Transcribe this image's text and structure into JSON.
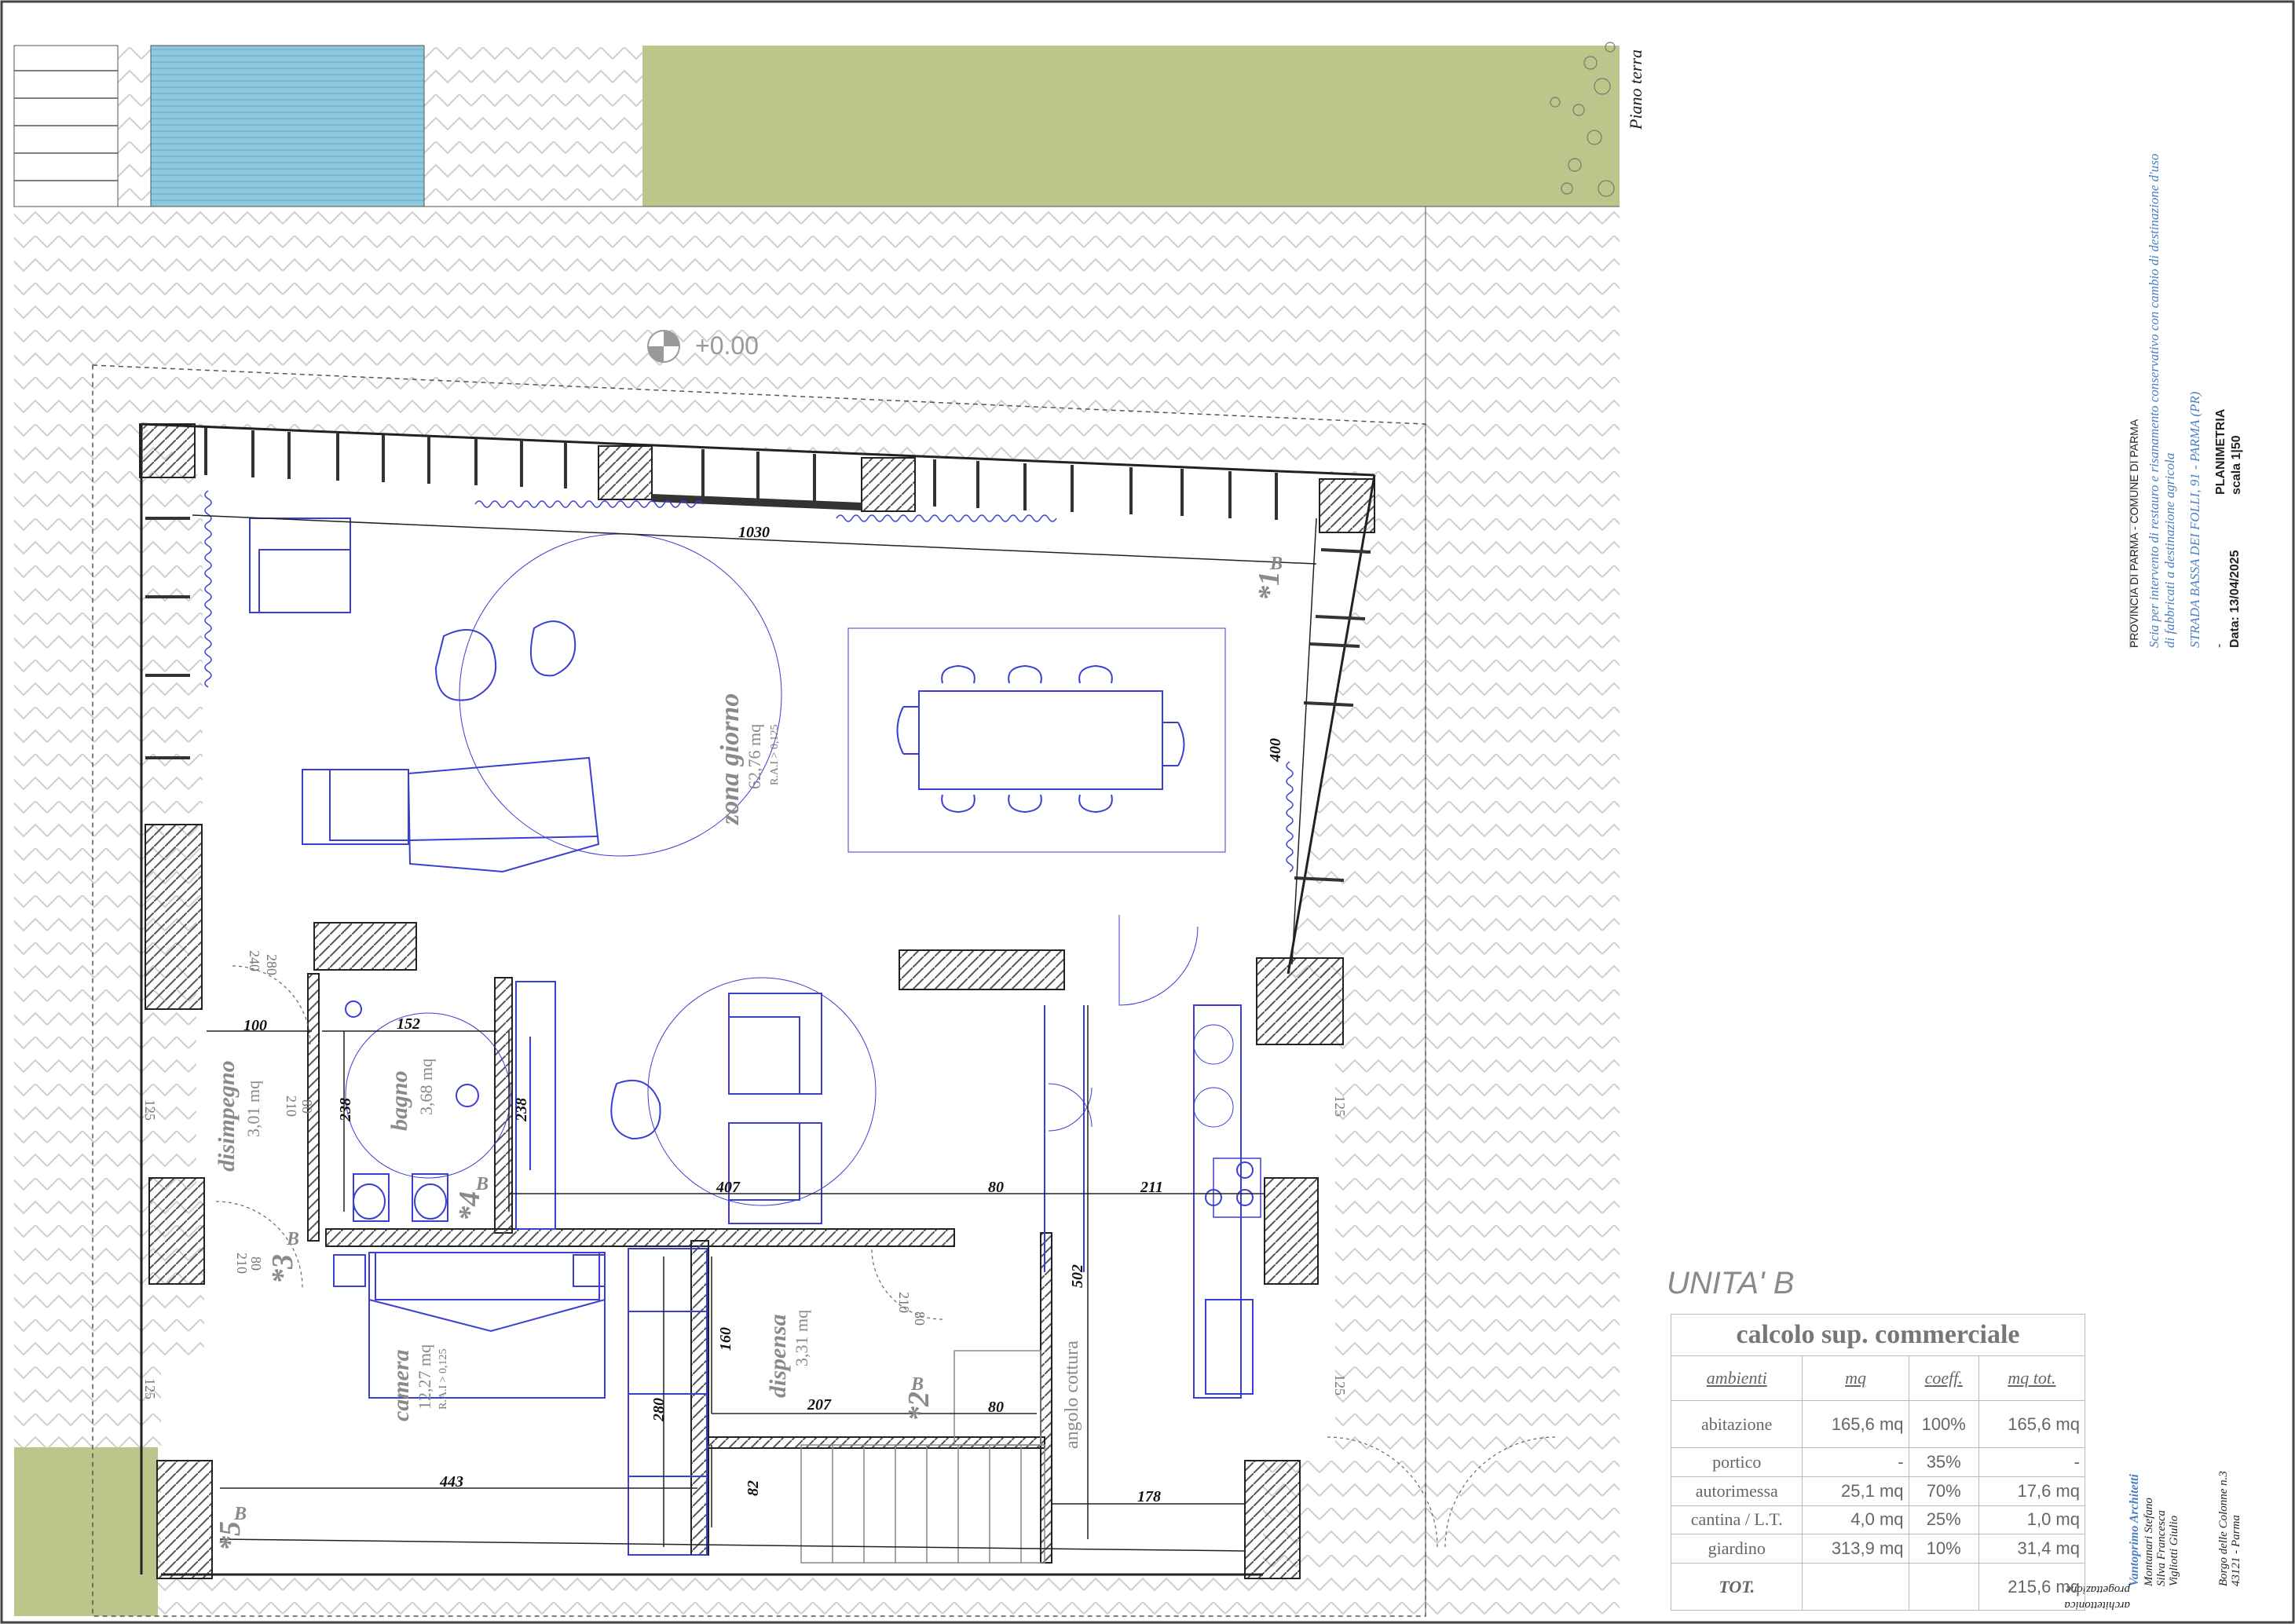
{
  "plan": {
    "level_label": "Piano terra",
    "elevation": "+0.00",
    "rooms": [
      {
        "id": "zona-giorno",
        "name": "zona giorno",
        "area": "62,76 mq",
        "ratio": "R.A.I > 0,125"
      },
      {
        "id": "disimpegno",
        "name": "disimpegno",
        "area": "3,01 mq"
      },
      {
        "id": "bagno",
        "name": "bagno",
        "area": "3,68 mq"
      },
      {
        "id": "camera",
        "name": "camera",
        "area": "12,27 mq",
        "ratio": "R.A.I > 0,125"
      },
      {
        "id": "dispensa",
        "name": "dispensa",
        "area": "3,31 mq"
      },
      {
        "id": "angolo-cottura",
        "name": "angolo cottura"
      }
    ],
    "dimensions": {
      "d1030": "1030",
      "d400": "400",
      "d100": "100",
      "d152": "152",
      "d238a": "238",
      "d238b": "238",
      "d407": "407",
      "d80a": "80",
      "d211": "211",
      "d502": "502",
      "d160": "160",
      "d207": "207",
      "d80b": "80",
      "d280": "280",
      "d443": "443",
      "d82": "82",
      "d178": "178"
    },
    "door_labels": {
      "w80": "80",
      "h210": "210",
      "w280": "280",
      "h240": "240",
      "w125": "125"
    },
    "tags": {
      "t1": "*1",
      "t2": "*2",
      "t3": "*3",
      "t4": "*4",
      "t5": "*5",
      "sub": "B"
    }
  },
  "title_block": {
    "authority": "PROVINCIA DI PARMA - COMUNE DI PARMA",
    "project_line1": "Scia per intervento di restauro e risanamento conservativo con cambio di destinazione d'uso",
    "project_line2": "di fabbricati a destinazione agricola",
    "address": "STRADA BASSA DEI FOLLI, 91 - PARMA (PR)",
    "date": "Data: 13/04/2025",
    "dash": "-",
    "drawing": "PLANIMETRIA",
    "scale": "scala 1|50"
  },
  "credits": {
    "studio": "Vantoprimo Architetti",
    "people": [
      "Montanari Stefano",
      "Silva Francesca",
      "Vigliotti Giulio"
    ],
    "address1": "Borgo delle Colonne n.3",
    "address2": "43121 - Parma",
    "role1": "progettazione",
    "role2": "architettonica"
  },
  "table": {
    "unit": "UNITA' B",
    "title": "calcolo sup. commerciale",
    "headers": [
      "ambienti",
      "mq",
      "coeff.",
      "mq tot."
    ],
    "rows": [
      [
        "abitazione",
        "165,6 mq",
        "100%",
        "165,6 mq"
      ],
      [
        "portico",
        "-",
        "35%",
        "-"
      ],
      [
        "autorimessa",
        "25,1 mq",
        "70%",
        "17,6 mq"
      ],
      [
        "cantina / L.T.",
        "4,0 mq",
        "25%",
        "1,0 mq"
      ],
      [
        "giardino",
        "313,9 mq",
        "10%",
        "31,4 mq"
      ]
    ],
    "total_label": "TOT.",
    "total": "215,6 mq"
  },
  "colors": {
    "grass": "#bcc58a",
    "pool": "#8cc8df",
    "furniture": "#3a3fd1",
    "wall": "#222",
    "hatch": "#c9c9c9"
  }
}
